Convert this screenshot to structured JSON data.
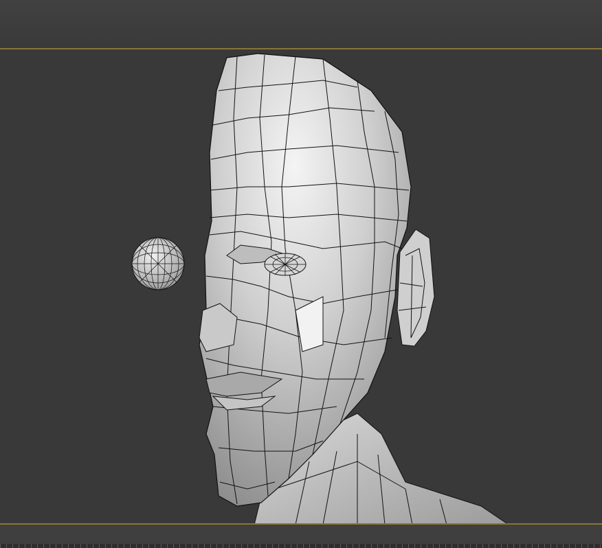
{
  "app": {
    "type": "3d-modeling-viewport"
  },
  "viewport": {
    "model": {
      "head": "low-poly-head-mesh",
      "eye_sphere": "eyeball-sphere-mesh"
    },
    "shading": "wireframe-on-shaded",
    "frame_color": "#8a7436",
    "background_color": "#393939",
    "mesh_color": "#c8c8c8",
    "wire_color": "#111111"
  },
  "timeline": {
    "visible": true
  }
}
